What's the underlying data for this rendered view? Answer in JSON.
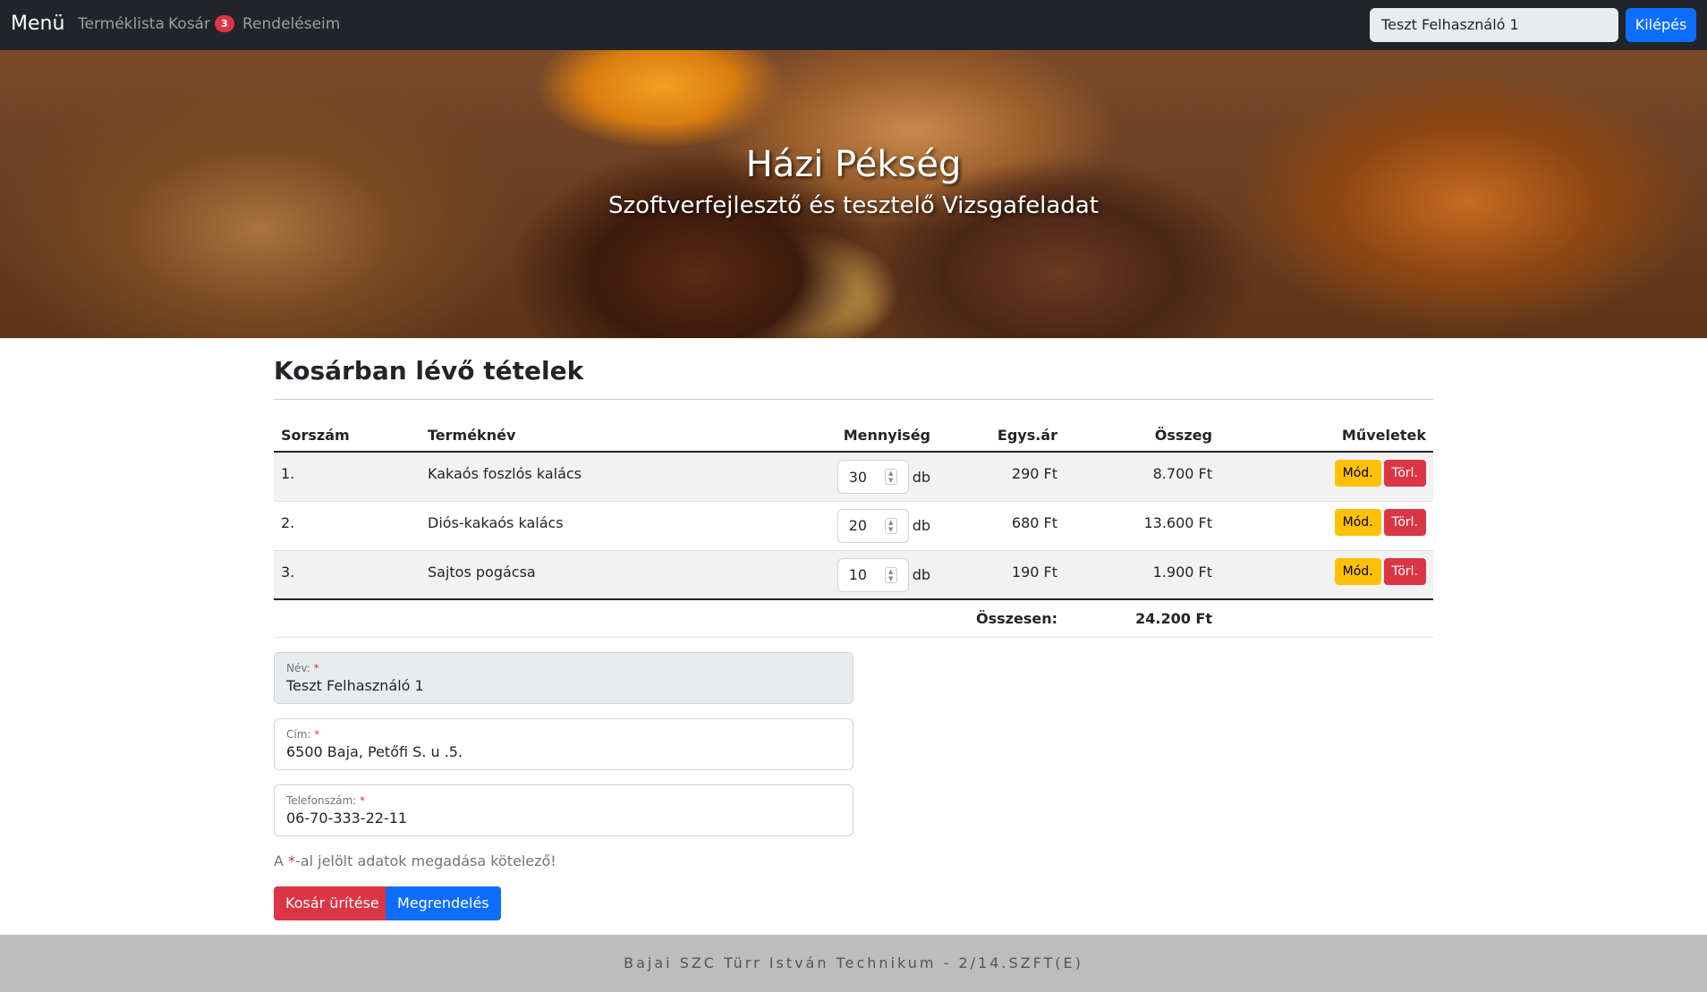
{
  "navbar": {
    "brand": "Menü",
    "links": [
      {
        "label": "Terméklista"
      },
      {
        "label": "Kosár",
        "badge": "3"
      },
      {
        "label": "Rendeléseim"
      }
    ],
    "user_name": "Teszt Felhasználó 1",
    "logout_label": "Kilépés"
  },
  "hero": {
    "title": "Házi Pékség",
    "subtitle": "Szoftverfejlesztő és tesztelő Vizsgafeladat"
  },
  "cart": {
    "title": "Kosárban lévő tételek",
    "columns": [
      "Sorszám",
      "Terméknév",
      "Mennyiség",
      "Egys.ár",
      "Összeg",
      "Műveletek"
    ],
    "rows": [
      {
        "index": "1.",
        "name": "Kakaós foszlós kalács",
        "qty": "30",
        "unit": "db",
        "price": "290 Ft",
        "sum": "8.700 Ft"
      },
      {
        "index": "2.",
        "name": "Diós-kakaós kalács",
        "qty": "20",
        "unit": "db",
        "price": "680 Ft",
        "sum": "13.600 Ft"
      },
      {
        "index": "3.",
        "name": "Sajtos pogácsa",
        "qty": "10",
        "unit": "db",
        "price": "190 Ft",
        "sum": "1.900 Ft"
      }
    ],
    "modify_label": "Mód.",
    "delete_label": "Törl.",
    "total_label": "Összesen:",
    "total_value": "24.200 Ft"
  },
  "form": {
    "name": {
      "label": "Név:",
      "required": "*",
      "value": "Teszt Felhasználó 1"
    },
    "address": {
      "label": "Cím:",
      "required": "*",
      "value": "6500 Baja, Petőfi S. u .5."
    },
    "phone": {
      "label": "Telefonszám:",
      "required": "*",
      "value": "06-70-333-22-11"
    },
    "note_prefix": "A ",
    "note_star": "*",
    "note_suffix": "-al jelölt adatok megadása kötelező!",
    "empty_cart_label": "Kosár ürítése",
    "order_label": "Megrendelés"
  },
  "footer": {
    "text": "Bajai SZC Türr István Technikum - 2/14.SZFT(E)"
  },
  "colors": {
    "navbar_bg": "#212529",
    "primary": "#0d6efd",
    "danger": "#dc3545",
    "warning": "#ffc107",
    "footer_bg": "#bdbdbd"
  }
}
